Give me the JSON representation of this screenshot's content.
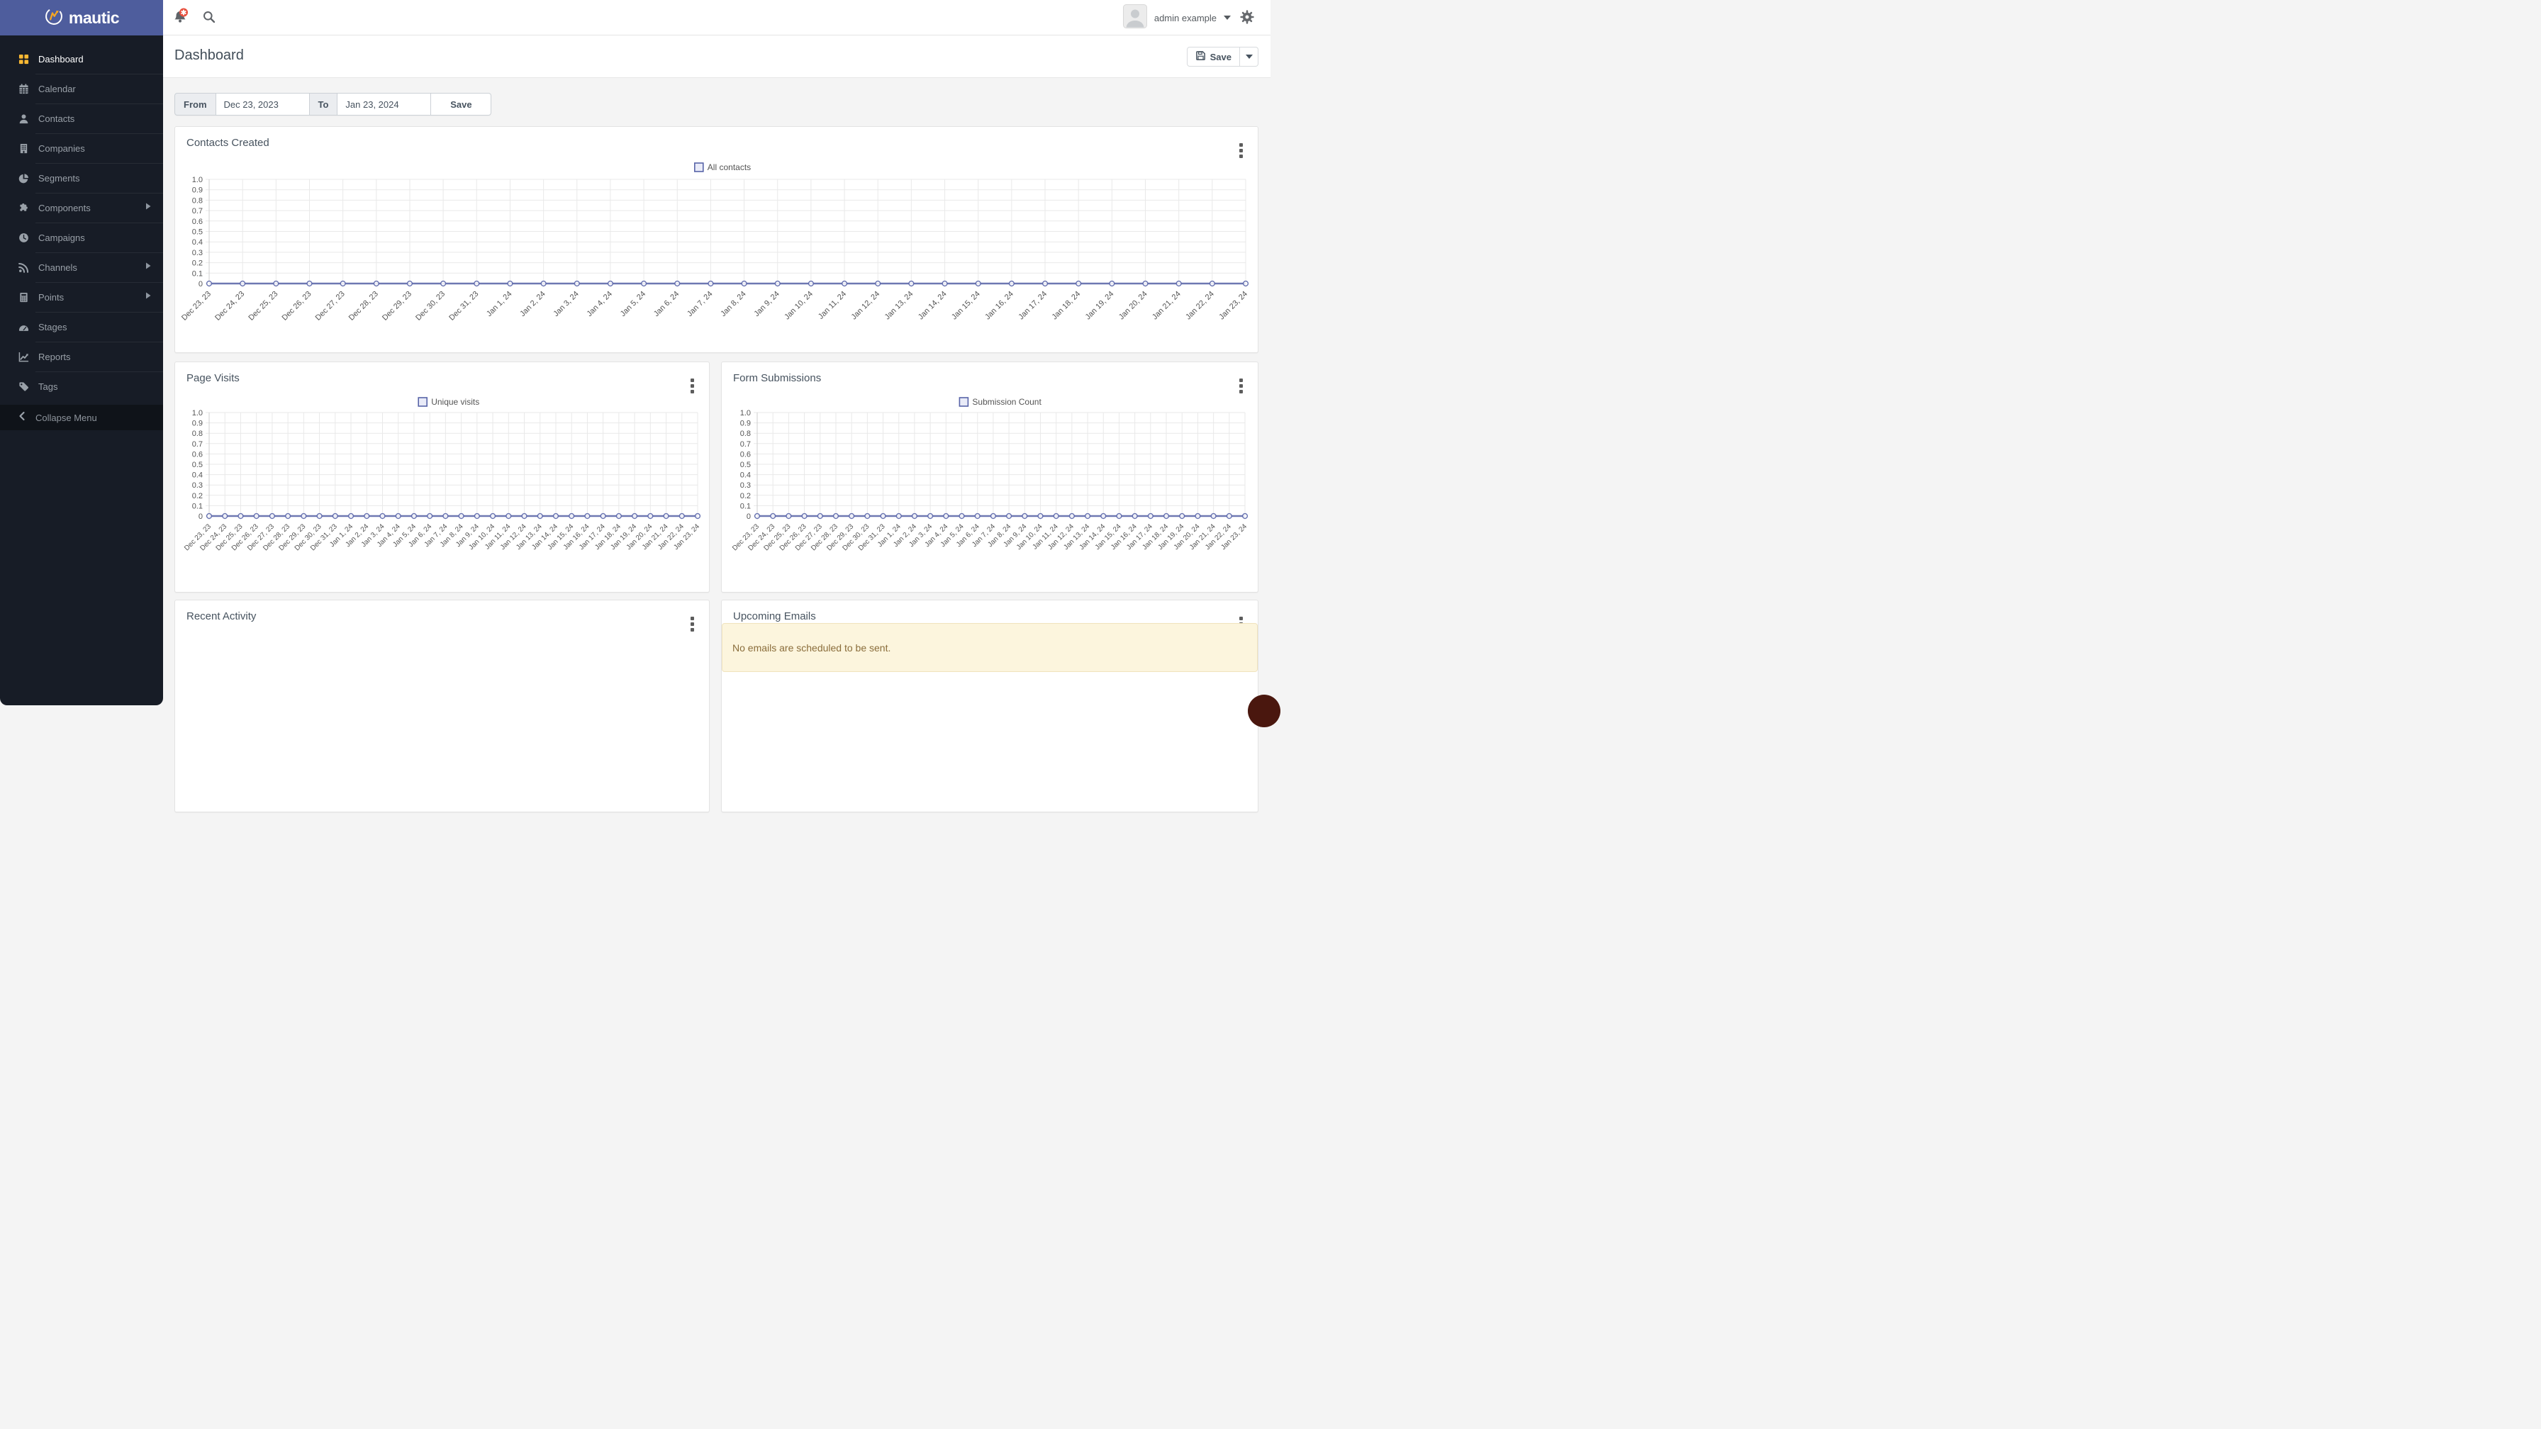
{
  "brand": {
    "logo_text": "mautic"
  },
  "topbar": {
    "user_name": "admin example"
  },
  "page": {
    "title": "Dashboard"
  },
  "header_actions": {
    "save_label": "Save"
  },
  "date_filter": {
    "from_label": "From",
    "from_value": "Dec 23, 2023",
    "to_label": "To",
    "to_value": "Jan 23, 2024",
    "save_label": "Save"
  },
  "sidebar": {
    "items": [
      {
        "label": "Dashboard",
        "active": true,
        "has_submenu": false
      },
      {
        "label": "Calendar",
        "active": false,
        "has_submenu": false
      },
      {
        "label": "Contacts",
        "active": false,
        "has_submenu": false
      },
      {
        "label": "Companies",
        "active": false,
        "has_submenu": false
      },
      {
        "label": "Segments",
        "active": false,
        "has_submenu": false
      },
      {
        "label": "Components",
        "active": false,
        "has_submenu": true
      },
      {
        "label": "Campaigns",
        "active": false,
        "has_submenu": false
      },
      {
        "label": "Channels",
        "active": false,
        "has_submenu": true
      },
      {
        "label": "Points",
        "active": false,
        "has_submenu": true
      },
      {
        "label": "Stages",
        "active": false,
        "has_submenu": false
      },
      {
        "label": "Reports",
        "active": false,
        "has_submenu": false
      },
      {
        "label": "Tags",
        "active": false,
        "has_submenu": false
      }
    ],
    "collapse_label": "Collapse Menu"
  },
  "panels": {
    "contacts_created": {
      "title": "Contacts Created"
    },
    "page_visits": {
      "title": "Page Visits"
    },
    "form_submissions": {
      "title": "Form Submissions"
    },
    "recent_activity": {
      "title": "Recent Activity"
    },
    "upcoming_emails": {
      "title": "Upcoming Emails",
      "empty_message": "No emails are scheduled to be sent."
    }
  },
  "colors": {
    "primary_blue": "#4e5d9d",
    "sidebar_bg": "#171c26",
    "active_icon_orange": "#fdb933",
    "chart_line": "#5864a8",
    "chart_legend_fill": "#e9ebf8",
    "alert_bg": "#fcf5dd",
    "alert_text": "#8a6d3b",
    "badge_red": "#e8503e"
  },
  "chart_data": [
    {
      "type": "line",
      "title": "Contacts Created",
      "legend_position": "top",
      "grid": true,
      "xlabel": "",
      "ylabel": "",
      "ylim": [
        0,
        1
      ],
      "yticks": [
        "1.0",
        "0.9",
        "0.8",
        "0.7",
        "0.6",
        "0.5",
        "0.4",
        "0.3",
        "0.2",
        "0.1",
        "0"
      ],
      "categories": [
        "Dec 23, 23",
        "Dec 24, 23",
        "Dec 25, 23",
        "Dec 26, 23",
        "Dec 27, 23",
        "Dec 28, 23",
        "Dec 29, 23",
        "Dec 30, 23",
        "Dec 31, 23",
        "Jan 1, 24",
        "Jan 2, 24",
        "Jan 3, 24",
        "Jan 4, 24",
        "Jan 5, 24",
        "Jan 6, 24",
        "Jan 7, 24",
        "Jan 8, 24",
        "Jan 9, 24",
        "Jan 10, 24",
        "Jan 11, 24",
        "Jan 12, 24",
        "Jan 13, 24",
        "Jan 14, 24",
        "Jan 15, 24",
        "Jan 16, 24",
        "Jan 17, 24",
        "Jan 18, 24",
        "Jan 19, 24",
        "Jan 20, 24",
        "Jan 21, 24",
        "Jan 22, 24",
        "Jan 23, 24"
      ],
      "series": [
        {
          "name": "All contacts",
          "values": [
            0,
            0,
            0,
            0,
            0,
            0,
            0,
            0,
            0,
            0,
            0,
            0,
            0,
            0,
            0,
            0,
            0,
            0,
            0,
            0,
            0,
            0,
            0,
            0,
            0,
            0,
            0,
            0,
            0,
            0,
            0,
            0
          ]
        }
      ]
    },
    {
      "type": "line",
      "title": "Page Visits",
      "legend_position": "top",
      "grid": true,
      "xlabel": "",
      "ylabel": "",
      "ylim": [
        0,
        1
      ],
      "yticks": [
        "1.0",
        "0.9",
        "0.8",
        "0.7",
        "0.6",
        "0.5",
        "0.4",
        "0.3",
        "0.2",
        "0.1",
        "0"
      ],
      "categories": [
        "Dec 23, 23",
        "Dec 24, 23",
        "Dec 25, 23",
        "Dec 26, 23",
        "Dec 27, 23",
        "Dec 28, 23",
        "Dec 29, 23",
        "Dec 30, 23",
        "Dec 31, 23",
        "Jan 1, 24",
        "Jan 2, 24",
        "Jan 3, 24",
        "Jan 4, 24",
        "Jan 5, 24",
        "Jan 6, 24",
        "Jan 7, 24",
        "Jan 8, 24",
        "Jan 9, 24",
        "Jan 10, 24",
        "Jan 11, 24",
        "Jan 12, 24",
        "Jan 13, 24",
        "Jan 14, 24",
        "Jan 15, 24",
        "Jan 16, 24",
        "Jan 17, 24",
        "Jan 18, 24",
        "Jan 19, 24",
        "Jan 20, 24",
        "Jan 21, 24",
        "Jan 22, 24",
        "Jan 23, 24"
      ],
      "series": [
        {
          "name": "Unique visits",
          "values": [
            0,
            0,
            0,
            0,
            0,
            0,
            0,
            0,
            0,
            0,
            0,
            0,
            0,
            0,
            0,
            0,
            0,
            0,
            0,
            0,
            0,
            0,
            0,
            0,
            0,
            0,
            0,
            0,
            0,
            0,
            0,
            0
          ]
        }
      ]
    },
    {
      "type": "line",
      "title": "Form Submissions",
      "legend_position": "top",
      "grid": true,
      "xlabel": "",
      "ylabel": "",
      "ylim": [
        0,
        1
      ],
      "yticks": [
        "1.0",
        "0.9",
        "0.8",
        "0.7",
        "0.6",
        "0.5",
        "0.4",
        "0.3",
        "0.2",
        "0.1",
        "0"
      ],
      "categories": [
        "Dec 23, 23",
        "Dec 24, 23",
        "Dec 25, 23",
        "Dec 26, 23",
        "Dec 27, 23",
        "Dec 28, 23",
        "Dec 29, 23",
        "Dec 30, 23",
        "Dec 31, 23",
        "Jan 1, 24",
        "Jan 2, 24",
        "Jan 3, 24",
        "Jan 4, 24",
        "Jan 5, 24",
        "Jan 6, 24",
        "Jan 7, 24",
        "Jan 8, 24",
        "Jan 9, 24",
        "Jan 10, 24",
        "Jan 11, 24",
        "Jan 12, 24",
        "Jan 13, 24",
        "Jan 14, 24",
        "Jan 15, 24",
        "Jan 16, 24",
        "Jan 17, 24",
        "Jan 18, 24",
        "Jan 19, 24",
        "Jan 20, 24",
        "Jan 21, 24",
        "Jan 22, 24",
        "Jan 23, 24"
      ],
      "series": [
        {
          "name": "Submission Count",
          "values": [
            0,
            0,
            0,
            0,
            0,
            0,
            0,
            0,
            0,
            0,
            0,
            0,
            0,
            0,
            0,
            0,
            0,
            0,
            0,
            0,
            0,
            0,
            0,
            0,
            0,
            0,
            0,
            0,
            0,
            0,
            0,
            0
          ]
        }
      ]
    }
  ]
}
